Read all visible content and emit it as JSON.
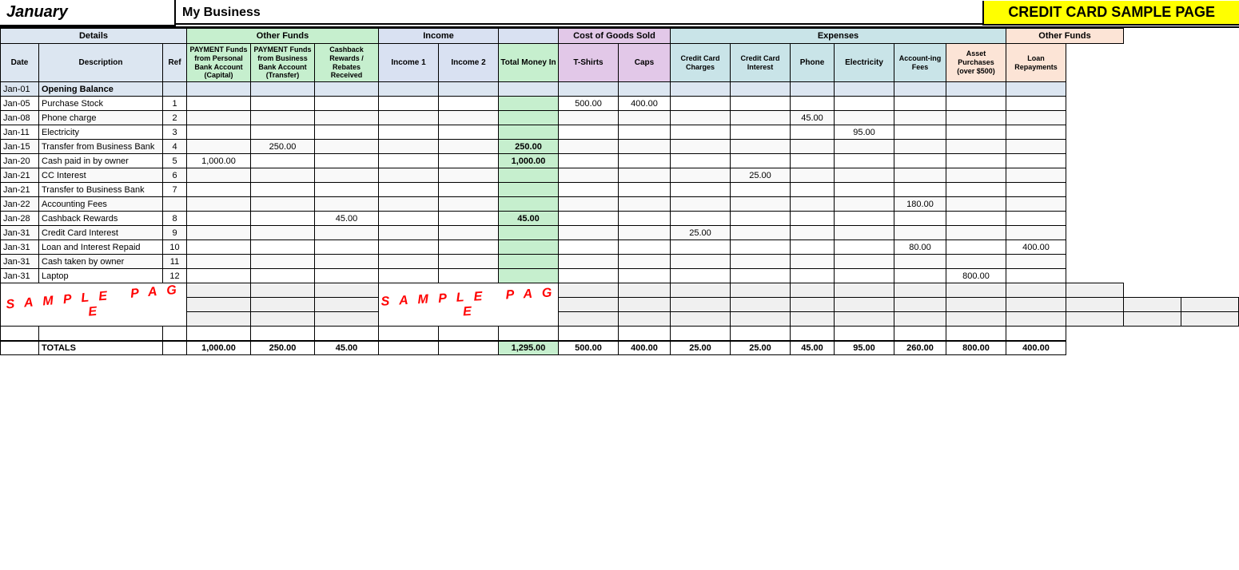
{
  "header": {
    "month": "January",
    "business": "My Business",
    "credit_card_title": "CREDIT CARD SAMPLE PAGE"
  },
  "column_groups": {
    "details": "Details",
    "other_funds": "Other Funds",
    "income": "Income",
    "cogs": "Cost of Goods Sold",
    "expenses": "Expenses",
    "other_funds2": "Other Funds"
  },
  "sub_headers": {
    "date": "Date",
    "description": "Description",
    "ref": "Ref",
    "payment_personal": "PAYMENT Funds from Personal Bank Account (Capital)",
    "payment_business": "PAYMENT Funds from Business Bank Account (Transfer)",
    "cashback": "Cashback Rewards / Rebates Received",
    "income1": "Income 1",
    "income2": "Income 2",
    "total_money_in": "Total Money In",
    "tshirts": "T-Shirts",
    "caps": "Caps",
    "cc_charges": "Credit Card Charges",
    "cc_interest": "Credit Card Interest",
    "phone": "Phone",
    "electricity": "Electricity",
    "accounting_fees": "Account-ing Fees",
    "asset_purchases": "Asset Purchases (over $500)",
    "loan_repayments": "Loan Repayments"
  },
  "rows": [
    {
      "date": "Jan-01",
      "desc": "Opening Balance",
      "ref": "",
      "pay_personal": "",
      "pay_business": "",
      "cashback": "",
      "income1": "",
      "income2": "",
      "total_money": "",
      "tshirts": "",
      "caps": "",
      "cc_charges": "",
      "cc_interest": "",
      "phone": "",
      "electricity": "",
      "accounting": "",
      "asset": "",
      "loan": "",
      "opening": true
    },
    {
      "date": "Jan-05",
      "desc": "Purchase Stock",
      "ref": "1",
      "pay_personal": "",
      "pay_business": "",
      "cashback": "",
      "income1": "",
      "income2": "",
      "total_money": "",
      "tshirts": "500.00",
      "caps": "400.00",
      "cc_charges": "",
      "cc_interest": "",
      "phone": "",
      "electricity": "",
      "accounting": "",
      "asset": "",
      "loan": ""
    },
    {
      "date": "Jan-08",
      "desc": "Phone charge",
      "ref": "2",
      "pay_personal": "",
      "pay_business": "",
      "cashback": "",
      "income1": "",
      "income2": "",
      "total_money": "",
      "tshirts": "",
      "caps": "",
      "cc_charges": "",
      "cc_interest": "",
      "phone": "45.00",
      "electricity": "",
      "accounting": "",
      "asset": "",
      "loan": ""
    },
    {
      "date": "Jan-11",
      "desc": "Electricity",
      "ref": "3",
      "pay_personal": "",
      "pay_business": "",
      "cashback": "",
      "income1": "",
      "income2": "",
      "total_money": "",
      "tshirts": "",
      "caps": "",
      "cc_charges": "",
      "cc_interest": "",
      "phone": "",
      "electricity": "95.00",
      "accounting": "",
      "asset": "",
      "loan": ""
    },
    {
      "date": "Jan-15",
      "desc": "Transfer from Business Bank",
      "ref": "4",
      "pay_personal": "",
      "pay_business": "250.00",
      "cashback": "",
      "income1": "",
      "income2": "",
      "total_money": "250.00",
      "tshirts": "",
      "caps": "",
      "cc_charges": "",
      "cc_interest": "",
      "phone": "",
      "electricity": "",
      "accounting": "",
      "asset": "",
      "loan": "",
      "bold_total": true
    },
    {
      "date": "Jan-20",
      "desc": "Cash paid in by owner",
      "ref": "5",
      "pay_personal": "1,000.00",
      "pay_business": "",
      "cashback": "",
      "income1": "",
      "income2": "",
      "total_money": "1,000.00",
      "tshirts": "",
      "caps": "",
      "cc_charges": "",
      "cc_interest": "",
      "phone": "",
      "electricity": "",
      "accounting": "",
      "asset": "",
      "loan": "",
      "bold_total": true
    },
    {
      "date": "Jan-21",
      "desc": "CC Interest",
      "ref": "6",
      "pay_personal": "",
      "pay_business": "",
      "cashback": "",
      "income1": "",
      "income2": "",
      "total_money": "",
      "tshirts": "",
      "caps": "",
      "cc_charges": "",
      "cc_interest": "25.00",
      "phone": "",
      "electricity": "",
      "accounting": "",
      "asset": "",
      "loan": ""
    },
    {
      "date": "Jan-21",
      "desc": "Transfer to Business Bank",
      "ref": "7",
      "pay_personal": "",
      "pay_business": "",
      "cashback": "",
      "income1": "",
      "income2": "",
      "total_money": "",
      "tshirts": "",
      "caps": "",
      "cc_charges": "",
      "cc_interest": "",
      "phone": "",
      "electricity": "",
      "accounting": "",
      "asset": "",
      "loan": ""
    },
    {
      "date": "Jan-22",
      "desc": "Accounting Fees",
      "ref": "",
      "pay_personal": "",
      "pay_business": "",
      "cashback": "",
      "income1": "",
      "income2": "",
      "total_money": "",
      "tshirts": "",
      "caps": "",
      "cc_charges": "",
      "cc_interest": "",
      "phone": "",
      "electricity": "",
      "accounting": "180.00",
      "asset": "",
      "loan": ""
    },
    {
      "date": "Jan-28",
      "desc": "Cashback Rewards",
      "ref": "8",
      "pay_personal": "",
      "pay_business": "",
      "cashback": "45.00",
      "income1": "",
      "income2": "",
      "total_money": "45.00",
      "tshirts": "",
      "caps": "",
      "cc_charges": "",
      "cc_interest": "",
      "phone": "",
      "electricity": "",
      "accounting": "",
      "asset": "",
      "loan": "",
      "bold_total": true
    },
    {
      "date": "Jan-31",
      "desc": "Credit Card Interest",
      "ref": "9",
      "pay_personal": "",
      "pay_business": "",
      "cashback": "",
      "income1": "",
      "income2": "",
      "total_money": "",
      "tshirts": "",
      "caps": "",
      "cc_charges": "25.00",
      "cc_interest": "",
      "phone": "",
      "electricity": "",
      "accounting": "",
      "asset": "",
      "loan": ""
    },
    {
      "date": "Jan-31",
      "desc": "Loan and Interest Repaid",
      "ref": "10",
      "pay_personal": "",
      "pay_business": "",
      "cashback": "",
      "income1": "",
      "income2": "",
      "total_money": "",
      "tshirts": "",
      "caps": "",
      "cc_charges": "",
      "cc_interest": "",
      "phone": "",
      "electricity": "",
      "accounting": "80.00",
      "asset": "",
      "loan": "400.00"
    },
    {
      "date": "Jan-31",
      "desc": "Cash taken by owner",
      "ref": "11",
      "pay_personal": "",
      "pay_business": "",
      "cashback": "",
      "income1": "",
      "income2": "",
      "total_money": "",
      "tshirts": "",
      "caps": "",
      "cc_charges": "",
      "cc_interest": "",
      "phone": "",
      "electricity": "",
      "accounting": "",
      "asset": "",
      "loan": ""
    },
    {
      "date": "Jan-31",
      "desc": "Laptop",
      "ref": "12",
      "pay_personal": "",
      "pay_business": "",
      "cashback": "",
      "income1": "",
      "income2": "",
      "total_money": "",
      "tshirts": "",
      "caps": "",
      "cc_charges": "",
      "cc_interest": "",
      "phone": "",
      "electricity": "",
      "accounting": "",
      "asset": "800.00",
      "loan": ""
    }
  ],
  "sample_rows": [
    {
      "empty": true
    },
    {
      "empty": true
    },
    {
      "empty": true
    }
  ],
  "totals": {
    "label": "TOTALS",
    "pay_personal": "1,000.00",
    "pay_business": "250.00",
    "cashback": "45.00",
    "income1": "",
    "income2": "",
    "total_money": "1,295.00",
    "tshirts": "500.00",
    "caps": "400.00",
    "cc_charges": "25.00",
    "cc_interest": "25.00",
    "phone": "45.00",
    "electricity": "95.00",
    "accounting": "260.00",
    "asset": "800.00",
    "loan": "400.00"
  }
}
